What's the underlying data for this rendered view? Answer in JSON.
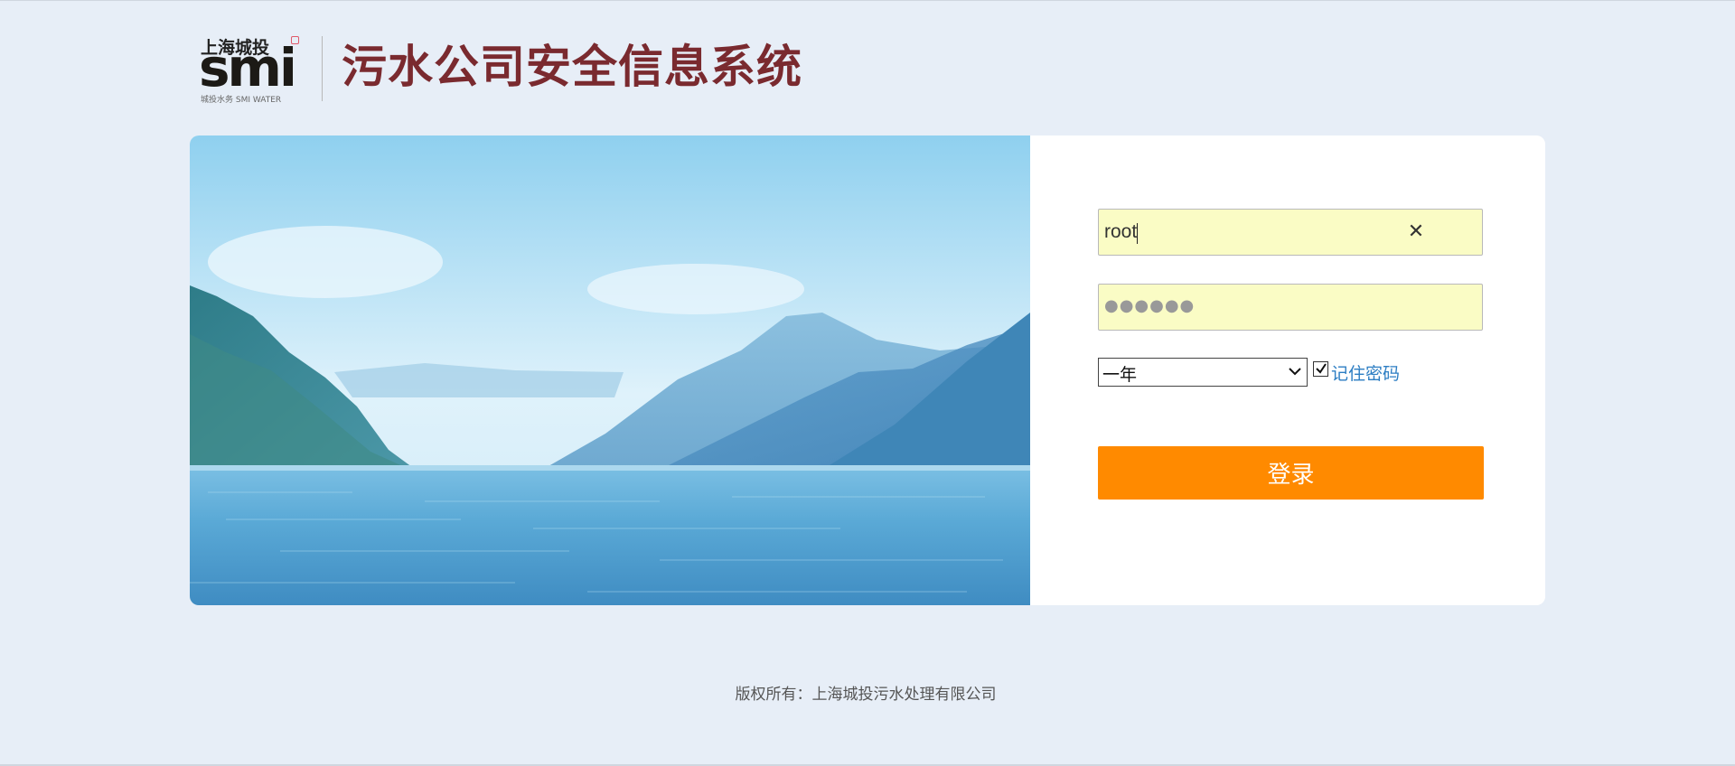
{
  "header": {
    "logo_cn": "上海城投",
    "logo_mark": "smi",
    "logo_sub": "城投水务 SMI WATER",
    "system_title": "污水公司安全信息系统"
  },
  "login": {
    "username_value": "root",
    "clear_icon": "close-icon",
    "password_mask": "●●●●●●",
    "duration_selected": "一年",
    "remember_checked": true,
    "remember_label": "记住密码",
    "login_button_label": "登录"
  },
  "footer": {
    "copyright": "版权所有：上海城投污水处理有限公司"
  },
  "colors": {
    "background": "#e7eef7",
    "input_fill": "#fafcc5",
    "button": "#ff8a00",
    "link": "#2d7ec3",
    "title": "#7a2a2f"
  }
}
